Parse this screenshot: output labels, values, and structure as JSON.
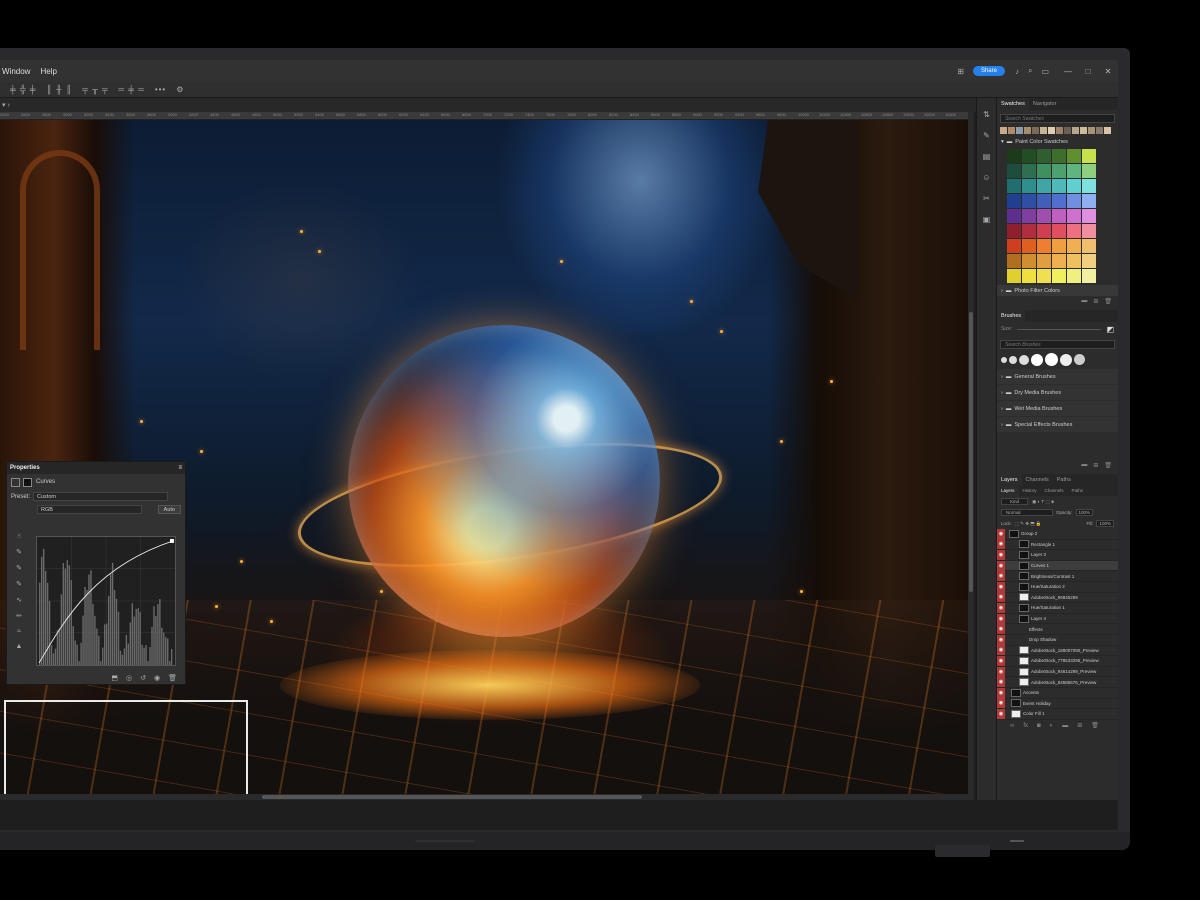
{
  "menu": {
    "items": [
      "Window",
      "Help"
    ],
    "share_label": "Share"
  },
  "window_controls": [
    "—",
    "□",
    "✕"
  ],
  "ruler_ticks": [
    "2400",
    "2600",
    "2800",
    "3000",
    "3200",
    "3400",
    "3600",
    "3800",
    "4000",
    "4200",
    "4400",
    "4600",
    "4800",
    "5000",
    "5200",
    "5400",
    "5600",
    "5800",
    "6000",
    "6200",
    "6400",
    "6600",
    "6800",
    "7000",
    "7200",
    "7400",
    "7600",
    "7800",
    "8000",
    "8200",
    "8400",
    "8600",
    "8800",
    "9000",
    "9200",
    "9400",
    "9600",
    "9800",
    "10000",
    "10200",
    "10400",
    "10600",
    "10800",
    "11000",
    "11200",
    "11400"
  ],
  "properties": {
    "title": "Properties",
    "adjustment": "Curves",
    "preset_label": "Preset:",
    "preset_value": "Custom",
    "channel": "RGB",
    "auto_label": "Auto"
  },
  "swatches": {
    "tabs": [
      "Swatches",
      "Navigator"
    ],
    "search_placeholder": "Search Swatches",
    "recent": [
      "#c9a98a",
      "#b08b6b",
      "#8f9aa8",
      "#a58e70",
      "#7f6a56",
      "#c8b497",
      "#e0cdb0",
      "#9b8268",
      "#6d5f52",
      "#b9a68e",
      "#cfb999",
      "#aa9275",
      "#8a7a6a",
      "#d8c4a5"
    ],
    "folder1": "Paint Color Swatches",
    "grid": [
      "#1b3b1b",
      "#234d23",
      "#2f5f2f",
      "#3d6e2b",
      "#5f8f2f",
      "#c9e04d",
      "#1d4d3d",
      "#2f6f4f",
      "#3f8f5f",
      "#4fa06f",
      "#5fb57f",
      "#8fd07f",
      "#1f6f6f",
      "#2f8f8f",
      "#3fa5a5",
      "#4fb9b9",
      "#5fcfcf",
      "#7fe0e0",
      "#1f3f8f",
      "#2f4fa5",
      "#3f5fb9",
      "#5070cf",
      "#6f8fe0",
      "#8fb0f0",
      "#5f2f8f",
      "#7f3f9f",
      "#9f4faf",
      "#bf5fbf",
      "#cf6fcf",
      "#df8fdf",
      "#8f1f2f",
      "#af2f3f",
      "#cf3f4f",
      "#df4f5f",
      "#ef6f7f",
      "#f08fa0",
      "#cf3f1f",
      "#df5f1f",
      "#ef7f2f",
      "#f09f3f",
      "#f0b04f",
      "#f0c06f",
      "#af6f1f",
      "#cf8f2f",
      "#df9f3f",
      "#efb04f",
      "#f0c05f",
      "#f0d07f",
      "#dfcf2f",
      "#efdf3f",
      "#f0e04f",
      "#f0f05f",
      "#f0f07f",
      "#f0f0a0"
    ],
    "folder2": "Photo Filter Colors"
  },
  "brushes": {
    "tab": "Brushes",
    "size_label": "Size:",
    "search_placeholder": "Search Brushes",
    "folders": [
      "General Brushes",
      "Dry Media Brushes",
      "Wet Media Brushes",
      "Special Effects Brushes"
    ]
  },
  "layers": {
    "tabs": [
      "Layers",
      "Channels",
      "Paths"
    ],
    "subtabs": [
      "Layers",
      "History",
      "Channels",
      "Paths"
    ],
    "kind_label": "Kind",
    "blend_mode": "Normal",
    "opacity_label": "Opacity:",
    "opacity_value": "100%",
    "lock_label": "Lock:",
    "fill_label": "Fill:",
    "fill_value": "100%",
    "rows": [
      "Group 2",
      "Rectangle 1",
      "Layer 3",
      "Curves 1",
      "Brightness/Contrast 1",
      "Hue/Saturation 2",
      "AdobeStock_96845299",
      "Hue/Saturation 1",
      "Layer 4",
      "Effects",
      "Drop Shadow",
      "AdobeStock_189007090_Preview",
      "AdobeStock_778533295_Preview",
      "AdobeStock_94614299_Preview",
      "AdobeStock_84585676_Preview",
      "Accents",
      "Event Holiday",
      "Color Fill 1"
    ]
  }
}
